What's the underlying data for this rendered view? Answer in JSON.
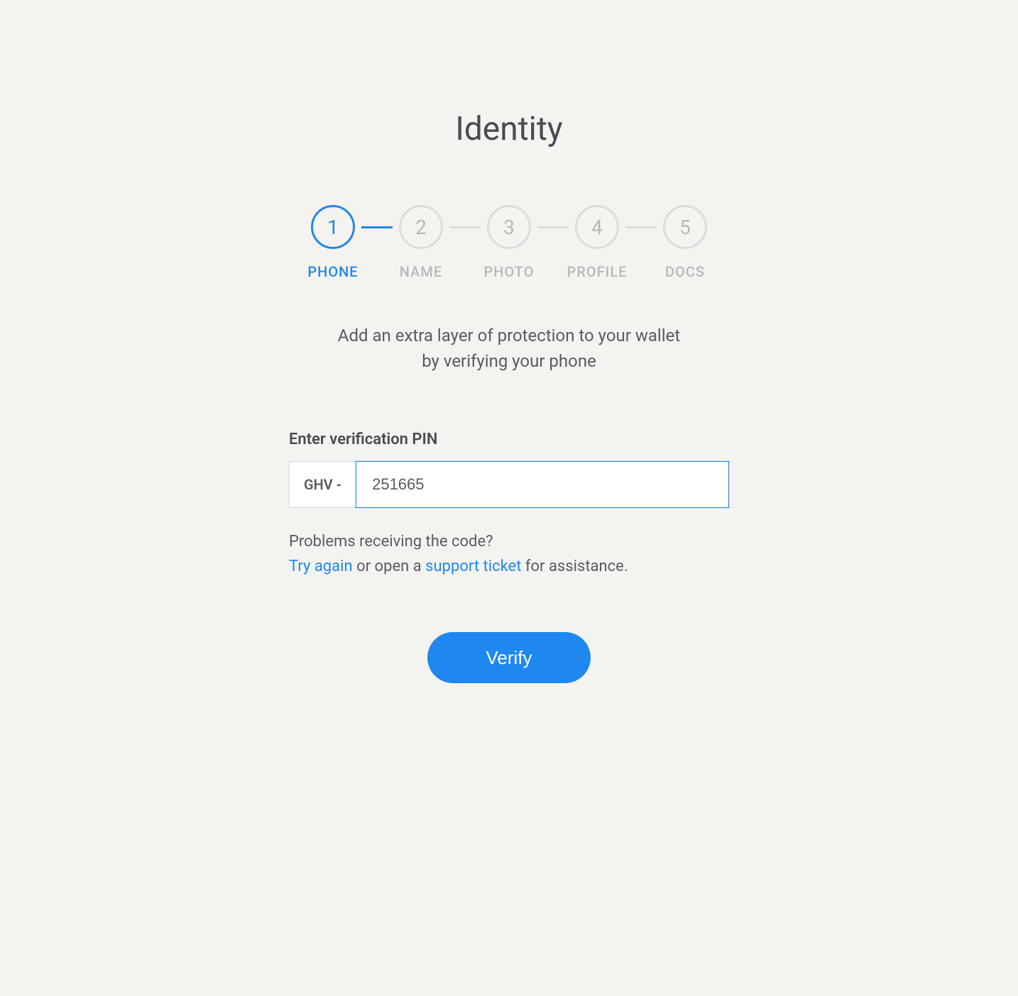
{
  "page": {
    "title": "Identity"
  },
  "stepper": {
    "steps": [
      {
        "number": "1",
        "label": "PHONE",
        "active": true
      },
      {
        "number": "2",
        "label": "NAME",
        "active": false
      },
      {
        "number": "3",
        "label": "PHOTO",
        "active": false
      },
      {
        "number": "4",
        "label": "PROFILE",
        "active": false
      },
      {
        "number": "5",
        "label": "DOCS",
        "active": false
      }
    ]
  },
  "description": "Add an extra layer of protection to your wallet by verifying your phone",
  "form": {
    "label": "Enter verification PIN",
    "prefix": "GHV -",
    "pin_value": "251665"
  },
  "help": {
    "question": "Problems receiving the code?",
    "try_again": "Try again",
    "mid_text": " or open a ",
    "support_ticket": "support ticket",
    "end_text": " for assistance."
  },
  "actions": {
    "verify_label": "Verify"
  }
}
